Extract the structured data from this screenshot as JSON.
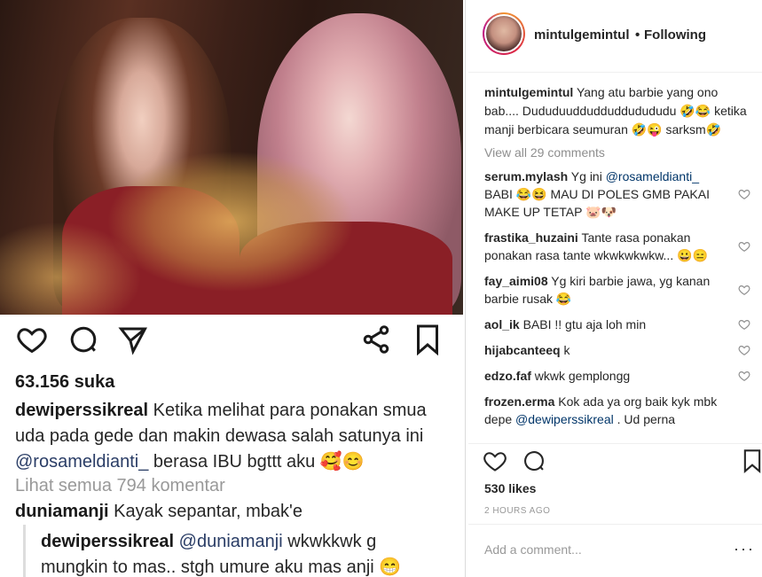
{
  "left_post": {
    "likes": "63.156 suka",
    "caption_lines": [
      {
        "user": "dewiperssikreal",
        "text": " Ketika melihat para ponakan smua"
      },
      {
        "text": "uda pada gede dan makin dewasa salah satunya ini"
      },
      {
        "mention": "@rosameldianti_",
        "text": " berasa IBU bgttt aku 🥰😊"
      }
    ],
    "view_all": "Lihat semua 794 komentar",
    "comments": [
      {
        "user": "duniamanji",
        "text": " Kayak sepantar, mbak'e"
      }
    ],
    "reply": {
      "user": "dewiperssikreal",
      "mention": "@duniamanji",
      "text": " wkwkkwk g",
      "line2": "mungkin to mas.. stgh umure aku mas anji 😁"
    }
  },
  "header": {
    "username": "mintulgemintul",
    "separator": "•",
    "follow_status": "Following"
  },
  "caption": {
    "user": "mintulgemintul",
    "text": " Yang atu barbie yang ono bab.... Dududuuddudduddudududu 🤣😂 ketika manji berbicara seumuran 🤣😜 sarksm🤣"
  },
  "view_all_comments": "View all 29 comments",
  "comments": [
    {
      "user": "serum.mylash",
      "pre": " Yg ini ",
      "mention": "@rosameldianti_",
      "text": " BABI 😂😆 MAU DI POLES GMB PAKAI MAKE UP TETAP 🐷🐶"
    },
    {
      "user": "frastika_huzaini",
      "pre": " Tante rasa ponakan ponakan rasa tante wkwkwkwkw... 😀😑",
      "mention": "",
      "text": ""
    },
    {
      "user": "fay_aimi08",
      "pre": " Yg kiri barbie jawa, yg kanan barbie rusak 😂",
      "mention": "",
      "text": ""
    },
    {
      "user": "aol_ik",
      "pre": " BABI !! gtu aja loh min",
      "mention": "",
      "text": ""
    },
    {
      "user": "hijabcanteeq",
      "pre": " k",
      "mention": "",
      "text": ""
    },
    {
      "user": "edzo.faf",
      "pre": " wkwk gemplongg",
      "mention": "",
      "text": ""
    },
    {
      "user": "frozen.erma",
      "pre": " Kok ada ya org baik kyk mbk depe ",
      "mention": "@dewiperssikreal",
      "text": " . Ud perna"
    }
  ],
  "stats": {
    "likes": "530 likes",
    "time": "2 HOURS AGO"
  },
  "add_comment": {
    "placeholder": "Add a comment..."
  },
  "icons": {
    "like": "heart-icon",
    "comment": "comment-bubble-icon",
    "share": "paper-plane-icon",
    "share_alt": "share-nodes-icon",
    "save": "bookmark-icon",
    "more": "more-dots-icon"
  },
  "colors": {
    "text": "#262626",
    "muted": "#8e8e8e",
    "mention": "#003569",
    "border": "#efefef"
  }
}
